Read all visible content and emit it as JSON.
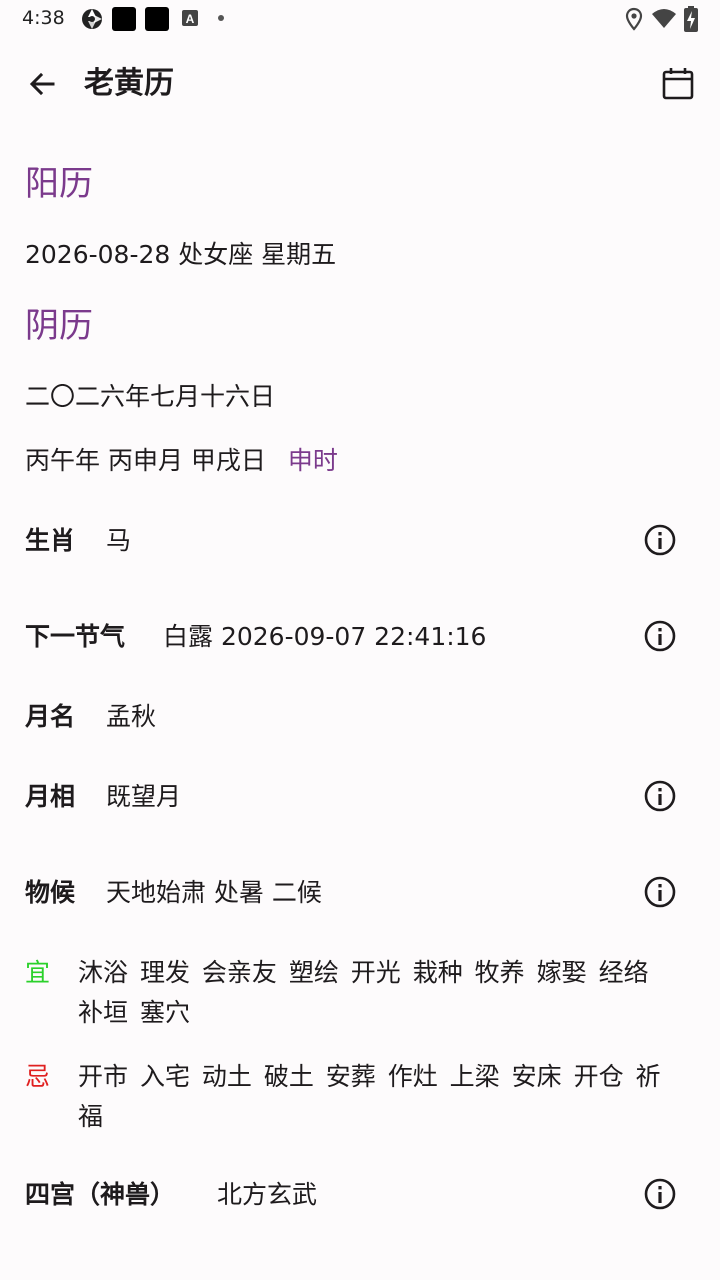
{
  "status_bar": {
    "time": "4:38",
    "icons": [
      "aperture-icon",
      "app-icon",
      "app-icon",
      "a-badge-icon",
      "dot-icon",
      "location-icon",
      "wifi-icon",
      "battery-charging-icon"
    ]
  },
  "app_bar": {
    "title": "老黄历",
    "back_icon": "arrow-back-icon",
    "calendar_icon": "calendar-icon"
  },
  "solar": {
    "heading": "阳历",
    "date_line": "2026-08-28 处女座 星期五"
  },
  "lunar": {
    "heading": "阴历",
    "date_line": "二〇二六年七月十六日",
    "ganzhi": "丙午年 丙申月 甲戌日",
    "hour": "申时"
  },
  "rows": {
    "zodiac": {
      "label": "生肖",
      "value": "马"
    },
    "next_term": {
      "label": "下一节气",
      "value": "白露 2026-09-07 22:41:16"
    },
    "month_name": {
      "label": "月名",
      "value": "孟秋"
    },
    "moon_phase": {
      "label": "月相",
      "value": "既望月"
    },
    "phenology": {
      "label": "物候",
      "value": "天地始肃 处暑 二候"
    },
    "four_palaces": {
      "label": "四宫（神兽）",
      "value": "北方玄武"
    }
  },
  "auspicious": {
    "mark": "宜",
    "items": "沐浴 理发 会亲友 塑绘 开光 栽种 牧养 嫁娶 经络 补垣 塞穴"
  },
  "inauspicious": {
    "mark": "忌",
    "items": "开市 入宅 动土 破土 安葬 作灶 上梁 安床 开仓 祈福"
  },
  "colors": {
    "accent": "#7b3a8c",
    "auspicious": "#2bd12b",
    "inauspicious": "#e02020",
    "background": "#fdfbfc",
    "text": "#1e1b1d"
  }
}
